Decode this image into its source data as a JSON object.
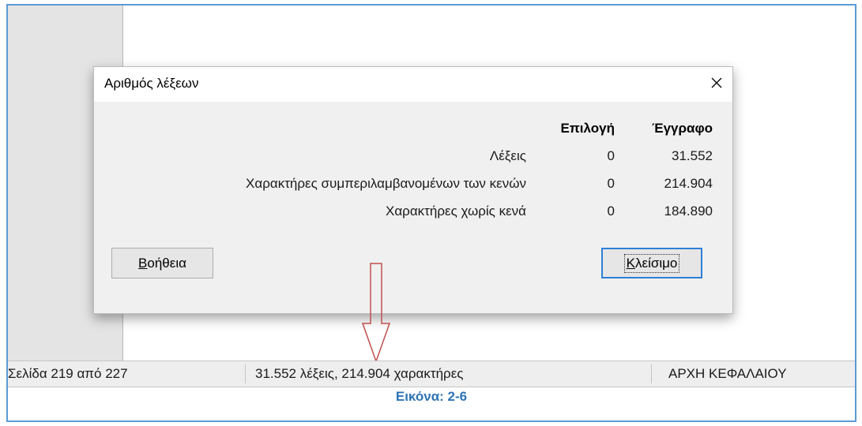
{
  "dialog": {
    "title": "Αριθμός λέξεων",
    "columns": {
      "selection": "Επιλογή",
      "document": "Έγγραφο"
    },
    "rows": [
      {
        "label": "Λέξεις",
        "selection": "0",
        "document": "31.552"
      },
      {
        "label": "Χαρακτήρες συμπεριλαμβανομένων των κενών",
        "selection": "0",
        "document": "214.904"
      },
      {
        "label": "Χαρακτήρες χωρίς κενά",
        "selection": "0",
        "document": "184.890"
      }
    ],
    "help_button": {
      "mnemonic": "Β",
      "rest": "οήθεια"
    },
    "close_button": {
      "mnemonic": "Κ",
      "rest": "λείσιμο"
    }
  },
  "statusbar": {
    "page": "Σελίδα 219 από 227",
    "count": "31.552 λέξεις, 214.904 χαρακτήρες",
    "style": "ΑΡΧΗ ΚΕΦΑΛΑΙΟΥ"
  },
  "caption": "Εικόνα: 2-6",
  "colors": {
    "frame": "#5b9bd5",
    "caption": "#2e74b5",
    "arrow": "#c0504d",
    "default_button": "#2d7fd8"
  },
  "icons": {
    "close": "close-icon",
    "arrow": "down-arrow-icon"
  }
}
